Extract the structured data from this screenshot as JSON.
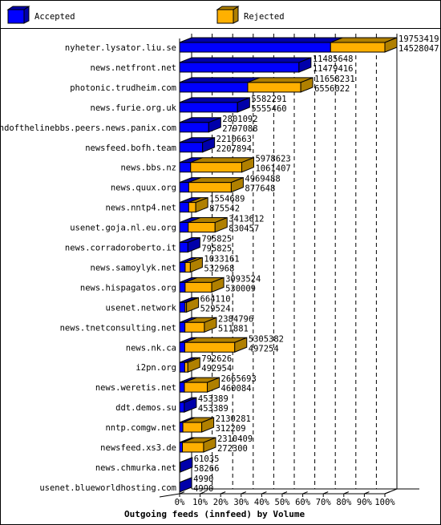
{
  "legend": {
    "accepted_label": "Accepted",
    "rejected_label": "Rejected"
  },
  "colors": {
    "accepted_front": "#0000ff",
    "accepted_side": "#0000aa",
    "rejected_front": "#ffb000",
    "rejected_side": "#b08000",
    "grid": "#000000"
  },
  "chart_data": {
    "type": "bar",
    "orientation": "horizontal",
    "stacked": true,
    "style": "3d",
    "title": "Outgoing feeds (innfeed) by Volume",
    "xlabel": "",
    "ylabel": "",
    "xlim": [
      0,
      100
    ],
    "x_unit": "% of largest total",
    "x_ticks": [
      "0%",
      "10%",
      "20%",
      "30%",
      "40%",
      "50%",
      "60%",
      "70%",
      "80%",
      "90%",
      "100%"
    ],
    "grid": true,
    "legend_position": "top",
    "categories": [
      "nyheter.lysator.liu.se",
      "news.netfront.net",
      "photonic.trudheim.com",
      "news.furie.org.uk",
      "endofthelinebbs.peers.news.panix.com",
      "newsfeed.bofh.team",
      "news.bbs.nz",
      "news.quux.org",
      "news.nntp4.net",
      "usenet.goja.nl.eu.org",
      "news.corradoroberto.it",
      "news.samoylyk.net",
      "news.hispagatos.org",
      "usenet.network",
      "news.tnetconsulting.net",
      "news.nk.ca",
      "i2pn.org",
      "news.weretis.net",
      "ddt.demos.su",
      "nntp.comgw.net",
      "newsfeed.xs3.de",
      "news.chmurka.net",
      "usenet.blueworldhosting.com"
    ],
    "totals": [
      19753419,
      11485648,
      11658231,
      5582291,
      2801092,
      2210663,
      5978623,
      4969488,
      1554689,
      3413612,
      795825,
      1033161,
      3093524,
      664110,
      2384796,
      5305382,
      792626,
      2665693,
      453389,
      2130281,
      2310409,
      61035,
      4990
    ],
    "series": [
      {
        "name": "Accepted",
        "values": [
          14528047,
          11479416,
          6556022,
          5555460,
          2797088,
          2207894,
          1061407,
          877648,
          875542,
          830457,
          795825,
          532968,
          530009,
          529524,
          511881,
          497254,
          492954,
          460084,
          453389,
          312209,
          272300,
          58266,
          4990
        ]
      },
      {
        "name": "Rejected",
        "values": [
          5225372,
          6232,
          5102209,
          26831,
          4004,
          2769,
          4917216,
          4091840,
          679147,
          2583155,
          0,
          500193,
          2563515,
          134586,
          1872915,
          4808128,
          299672,
          2205609,
          0,
          1818072,
          2038109,
          2769,
          0
        ]
      }
    ]
  }
}
